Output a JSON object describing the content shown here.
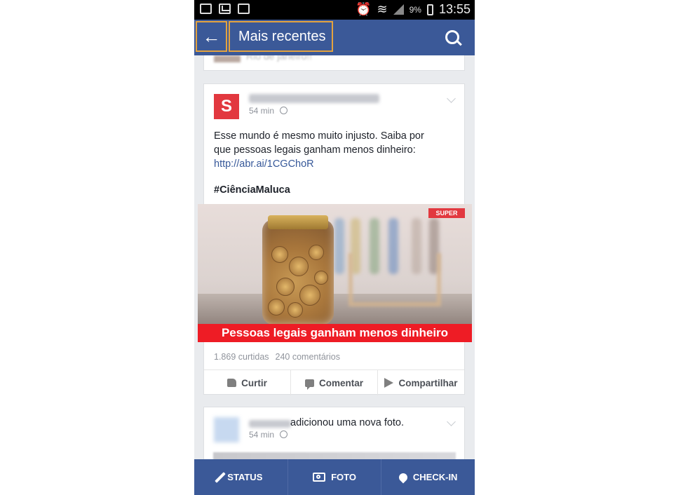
{
  "status_bar": {
    "battery": "9%",
    "time": "13:55"
  },
  "app_bar": {
    "title": "Mais recentes"
  },
  "previous_post": {
    "text": "Rio de janeiro!!"
  },
  "post": {
    "avatar_letter": "S",
    "time": "54 min",
    "text_line1": "Esse mundo é mesmo muito injusto. Saiba por",
    "text_line2": "que pessoas legais ganham menos dinheiro:",
    "link": "http://abr.ai/1CGChoR",
    "hashtag": "#CiênciaMaluca",
    "image_tag": "SUPER",
    "image_banner": "Pessoas legais ganham menos dinheiro",
    "likes": "1.869 curtidas",
    "comments": "240 comentários",
    "actions": {
      "like": "Curtir",
      "comment": "Comentar",
      "share": "Compartilhar"
    }
  },
  "next_post": {
    "text": "adicionou uma nova foto.",
    "time": "54 min"
  },
  "bottom_bar": {
    "status": "STATUS",
    "photo": "FOTO",
    "checkin": "CHECK-IN"
  },
  "colors": {
    "brand": "#3b5998",
    "highlight": "#e4a33f",
    "banner": "#ee1c25",
    "link": "#365899"
  }
}
